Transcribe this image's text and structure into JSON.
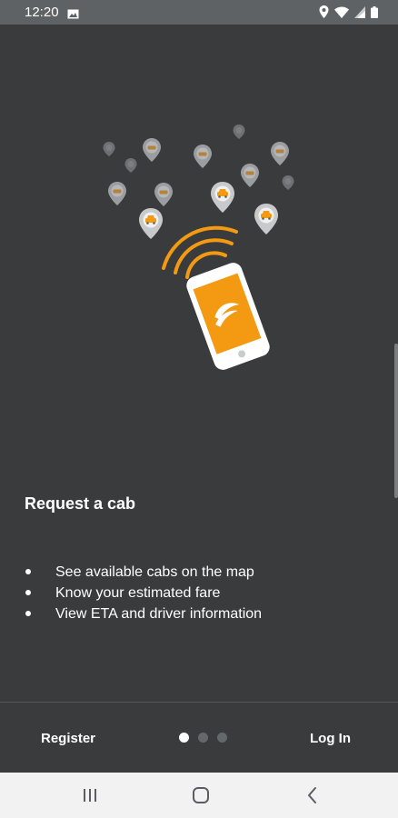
{
  "status_bar": {
    "time": "12:20",
    "icons": [
      "gallery-icon",
      "location-icon",
      "wifi-icon",
      "signal-icon",
      "battery-icon"
    ]
  },
  "onboarding": {
    "illustration": "phone-with-cab-location-pins",
    "headline": "Request a cab",
    "features": [
      "See available cabs on the map",
      "Know your estimated fare",
      "View ETA and driver information"
    ]
  },
  "bottom_bar": {
    "register_label": "Register",
    "login_label": "Log In",
    "page_count": 3,
    "current_page": 1
  },
  "nav_bar": {
    "icons": [
      "recent-apps-icon",
      "home-icon",
      "back-icon"
    ]
  },
  "colors": {
    "background": "#3a3b3c",
    "status_bar": "#5f6264",
    "accent": "#f39a12",
    "pin": "#c7c9cc",
    "nav_bar": "#f2f2f2"
  }
}
